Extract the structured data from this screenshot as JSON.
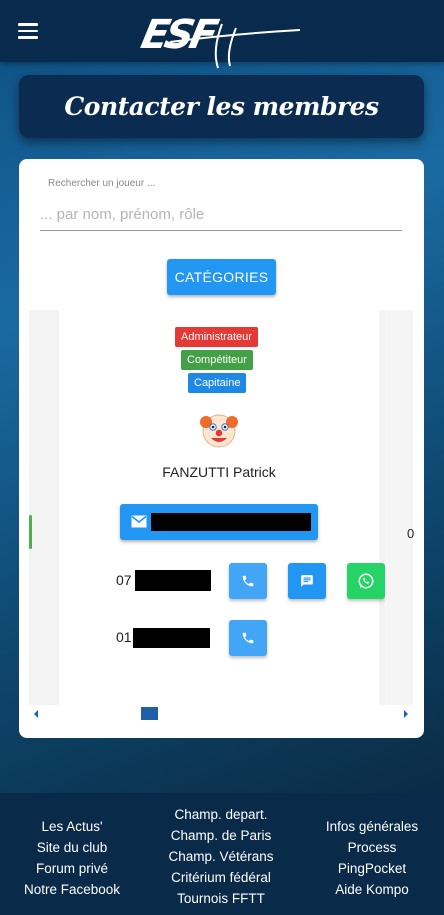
{
  "header": {
    "logo_text": "ESF"
  },
  "page": {
    "title": "Contacter les membres"
  },
  "search": {
    "label": "Rechercher un joueur ...",
    "placeholder": "... par nom, prénom, rôle"
  },
  "categories_button": "CATÉGORIES",
  "member": {
    "badges": [
      "Administrateur",
      "Compétiteur",
      "Capitaine"
    ],
    "name": "FANZUTTI Patrick",
    "phone1_prefix": "07",
    "phone2_prefix": "01"
  },
  "next_slide_peek": "0",
  "footer": {
    "col1": [
      "Les Actus'",
      "Site du club",
      "Forum privé",
      "Notre Facebook"
    ],
    "col2": [
      "Champ. depart.",
      "Champ. de Paris",
      "Champ. Vétérans",
      "Critérium fédéral",
      "Tournois FFTT"
    ],
    "col3": [
      "Infos générales",
      "Process",
      "PingPocket",
      "Aide Kompo"
    ]
  },
  "colors": {
    "topbar": "#082a4d",
    "primary": "#2196f3",
    "admin_badge": "#e53935",
    "competitor_badge": "#43a047",
    "captain_badge": "#1e88e5",
    "whatsapp": "#25d366"
  }
}
